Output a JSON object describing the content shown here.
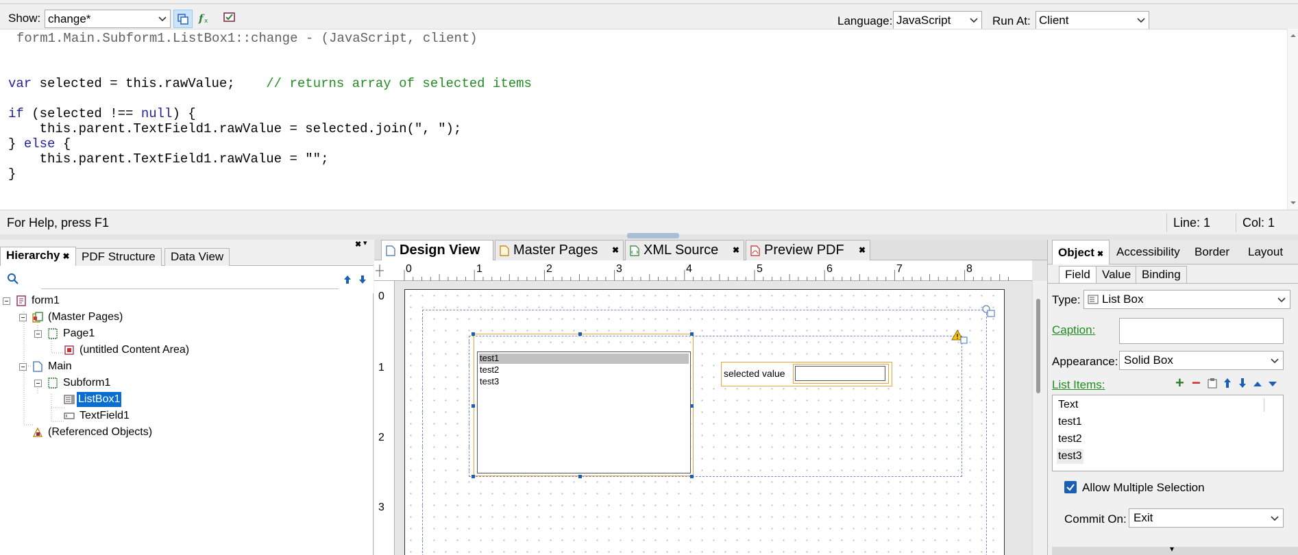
{
  "script_editor": {
    "show_label": "Show:",
    "show_value": "change*",
    "language_label": "Language:",
    "language_value": "JavaScript",
    "run_at_label": "Run At:",
    "run_at_value": "Client",
    "code": {
      "header": "form1.Main.Subform1.ListBox1::change - (JavaScript, client)",
      "l1_kw": "var",
      "l1_rest": " selected = this.rawValue;    ",
      "l1_comment": "// returns array of selected items",
      "l2_kw": "if",
      "l2_rest": " (selected !== ",
      "l2_kw2": "null",
      "l2_end": ") {",
      "l3": "    this.parent.TextField1.rawValue = selected.join(\", \");",
      "l4_start": "} ",
      "l4_kw": "else",
      "l4_end": " {",
      "l5": "    this.parent.TextField1.rawValue = \"\";",
      "l6": "}"
    },
    "status": {
      "help": "For Help, press F1",
      "line": "Line: 1",
      "col": "Col: 1"
    }
  },
  "hierarchy": {
    "tabs": [
      "Hierarchy",
      "PDF Structure",
      "Data View"
    ],
    "search_placeholder": "",
    "tree": {
      "form1": "form1",
      "master_pages": "(Master Pages)",
      "page1": "Page1",
      "content_area": "(untitled Content Area)",
      "main": "Main",
      "subform1": "Subform1",
      "listbox1": "ListBox1",
      "textfield1": "TextField1",
      "referenced": "(Referenced Objects)"
    }
  },
  "design": {
    "tabs": [
      "Design View",
      "Master Pages",
      "XML Source",
      "Preview PDF"
    ],
    "ruler_h": [
      "0",
      "1",
      "2",
      "3",
      "4",
      "5",
      "6",
      "7",
      "8"
    ],
    "ruler_v": [
      "0",
      "1",
      "2",
      "3"
    ],
    "listbox_items": [
      "test1",
      "test2",
      "test3"
    ],
    "text_field_caption": "selected value"
  },
  "object_panel": {
    "tabs": [
      "Object",
      "Accessibility",
      "Border",
      "Layout"
    ],
    "subtabs": [
      "Field",
      "Value",
      "Binding"
    ],
    "type_label": "Type:",
    "type_value": "List Box",
    "caption_label": "Caption:",
    "caption_value": "",
    "appearance_label": "Appearance:",
    "appearance_value": "Solid Box",
    "list_items_label": "List Items:",
    "list_items": [
      "Text",
      "test1",
      "test2",
      "test3"
    ],
    "allow_multiple_label": "Allow Multiple Selection",
    "allow_multiple_checked": true,
    "commit_on_label": "Commit On:",
    "commit_on_value": "Exit"
  },
  "colors": {
    "selection": "#0a6ed1",
    "keyword": "#1f1fa0",
    "comment": "#238b23",
    "link_label": "#1e8c1e",
    "field_border": "#e8a33d"
  }
}
